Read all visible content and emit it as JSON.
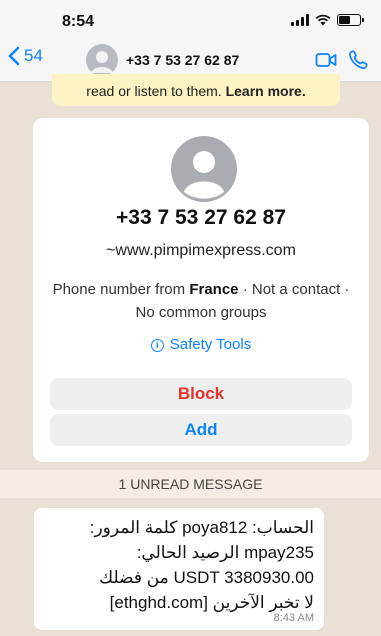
{
  "status_bar": {
    "time": "8:54",
    "signal_icon": "cellular-signal-icon",
    "wifi_icon": "wifi-icon",
    "battery_icon": "battery-icon",
    "battery_level": 0.6
  },
  "nav": {
    "back_count": "54",
    "back_icon": "chevron-left-icon",
    "title": "+33 7 53 27 62 87",
    "video_icon": "video-camera-icon",
    "phone_icon": "phone-icon",
    "accent": "#0a84ff"
  },
  "encryption_notice": {
    "text": "read or listen to them.",
    "link": "Learn more."
  },
  "contact_card": {
    "phone": "+33 7 53 27 62 87",
    "site": "~www.pimpimexpress.com",
    "info_prefix": "Phone number from ",
    "info_country": "France",
    "info_suffix": " · Not a contact · No common groups",
    "safety_label": "Safety Tools",
    "safety_icon": "info-icon",
    "block_label": "Block",
    "add_label": "Add",
    "block_color": "#e5322c"
  },
  "unread_banner": "1 UNREAD MESSAGE",
  "message": {
    "lines": [
      "الحساب: poya812 كلمة المرور:",
      "mpay235 الرصيد الحالي:",
      "USDT 3380930.00 من فضلك",
      "لا تخبر الآخرين [ethghd.com]"
    ],
    "time": "8:43 AM"
  }
}
